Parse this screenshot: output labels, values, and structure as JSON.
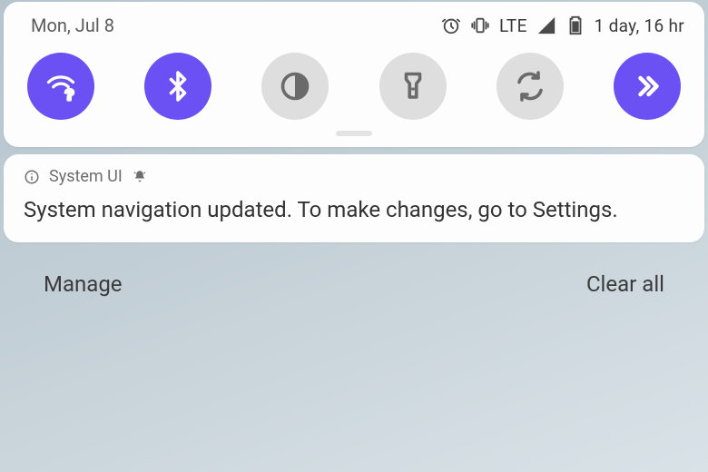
{
  "status": {
    "date": "Mon, Jul 8",
    "network_label": "LTE",
    "battery_label": "1 day, 16 hr"
  },
  "notification": {
    "app": "System UI",
    "body": "System navigation updated. To make changes, go to Settings."
  },
  "footer": {
    "manage": "Manage",
    "clear_all": "Clear all"
  }
}
